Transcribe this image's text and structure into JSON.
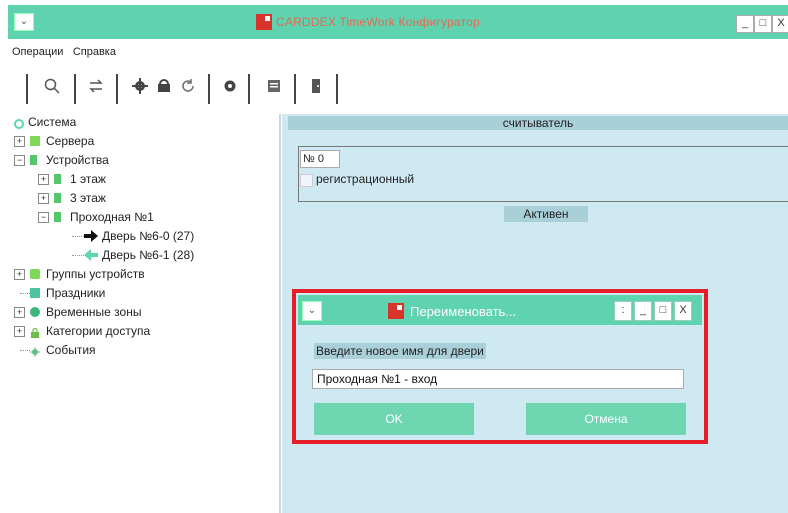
{
  "window": {
    "title": "CARDDEX TimeWork Конфигуратор",
    "menu_glyph": "⌄",
    "minimize": "_",
    "maximize": "□",
    "close": "X"
  },
  "menubar": [
    "Операции",
    "Справка"
  ],
  "toolbar": {
    "icons": [
      "search-icon",
      "swap-icon",
      "settings-icon",
      "device-icon",
      "refresh-icon",
      "gear-icon",
      "report-icon",
      "door-icon"
    ]
  },
  "tree": {
    "root": "Система",
    "items": [
      {
        "label": "Сервера"
      },
      {
        "label": "Устройства"
      },
      {
        "label": "1 этаж"
      },
      {
        "label": "3 этаж"
      },
      {
        "label": "Проходная №1"
      },
      {
        "label": "Дверь №6-0 (27)"
      },
      {
        "label": "Дверь №6-1 (28)"
      },
      {
        "label": "Группы устройств"
      },
      {
        "label": "Праздники"
      },
      {
        "label": "Временные зоны"
      },
      {
        "label": "Категории доступа"
      },
      {
        "label": "События"
      }
    ],
    "colors": {
      "server": "#7ed957",
      "device": "#54c76a",
      "holiday": "#4fc3a0",
      "zone": "#3fb57a",
      "lock": "#6dbd4a",
      "event": "#57c28a"
    }
  },
  "panel": {
    "header": "считыватель",
    "number": "№ 0",
    "checkbox_label": "регистрационный",
    "status": "Активен"
  },
  "dialog": {
    "title": "Переименовать...",
    "menu_glyph": "⌄",
    "extra": ":",
    "minimize": "_",
    "maximize": "□",
    "close": "X",
    "prompt": "Введите новое имя для двери",
    "input_value": "Проходная №1 - вход",
    "ok_label": "OK",
    "cancel_label": "Отмена"
  },
  "colors": {
    "accent": "#5fd3b0",
    "panel_bg": "#cfe9f3",
    "highlight": "#e61e28"
  }
}
